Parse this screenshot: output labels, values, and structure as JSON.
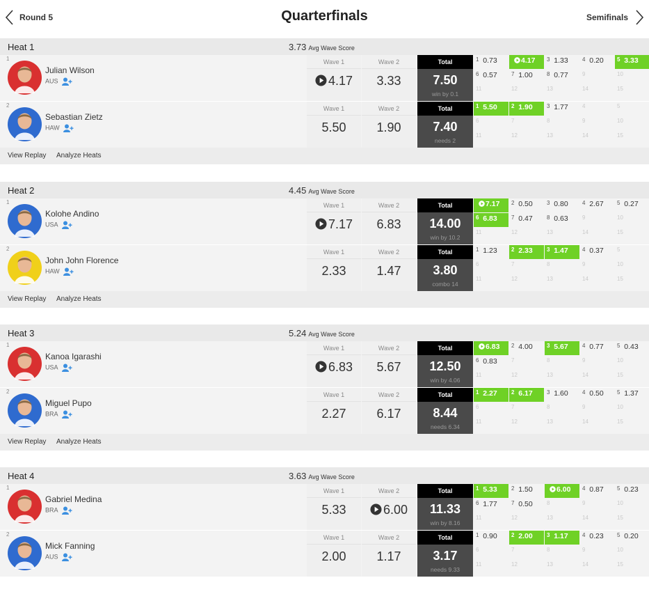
{
  "nav": {
    "prev_label": "Round 5",
    "title": "Quarterfinals",
    "next_label": "Semifinals"
  },
  "labels": {
    "avg": "Avg Wave Score",
    "wave1": "Wave 1",
    "wave2": "Wave 2",
    "total": "Total",
    "view_replay": "View Replay",
    "analyze_heats": "Analyze Heats"
  },
  "colors": {
    "accent_green": "#6fd126",
    "total_header": "#000000",
    "total_body": "#4a4a4a"
  },
  "heats": [
    {
      "name": "Heat 1",
      "avg": "3.73",
      "surfers": [
        {
          "seed": "1",
          "name": "Julian Wilson",
          "country": "AUS",
          "avatar_color": "#d93030",
          "wave1": "4.17",
          "wave1_play": true,
          "wave2": "3.33",
          "wave2_play": false,
          "total": "7.50",
          "note": "win by 0.1",
          "waves": [
            {
              "n": "1",
              "s": "0.73"
            },
            {
              "n": "",
              "s": "4.17",
              "g": true,
              "p": true
            },
            {
              "n": "3",
              "s": "1.33"
            },
            {
              "n": "4",
              "s": "0.20"
            },
            {
              "n": "5",
              "s": "3.33",
              "g": true
            },
            {
              "n": "6",
              "s": "0.57"
            },
            {
              "n": "7",
              "s": "1.00"
            },
            {
              "n": "8",
              "s": "0.77"
            },
            {
              "n": "9",
              "s": ""
            },
            {
              "n": "10",
              "s": ""
            },
            {
              "n": "11",
              "s": ""
            },
            {
              "n": "12",
              "s": ""
            },
            {
              "n": "13",
              "s": ""
            },
            {
              "n": "14",
              "s": ""
            },
            {
              "n": "15",
              "s": ""
            }
          ]
        },
        {
          "seed": "2",
          "name": "Sebastian Zietz",
          "country": "HAW",
          "avatar_color": "#2f6bcf",
          "wave1": "5.50",
          "wave1_play": false,
          "wave2": "1.90",
          "wave2_play": false,
          "total": "7.40",
          "note": "needs 2",
          "waves": [
            {
              "n": "1",
              "s": "5.50",
              "g": true
            },
            {
              "n": "2",
              "s": "1.90",
              "g": true
            },
            {
              "n": "3",
              "s": "1.77"
            },
            {
              "n": "4",
              "s": ""
            },
            {
              "n": "5",
              "s": ""
            },
            {
              "n": "6",
              "s": ""
            },
            {
              "n": "7",
              "s": ""
            },
            {
              "n": "8",
              "s": ""
            },
            {
              "n": "9",
              "s": ""
            },
            {
              "n": "10",
              "s": ""
            },
            {
              "n": "11",
              "s": ""
            },
            {
              "n": "12",
              "s": ""
            },
            {
              "n": "13",
              "s": ""
            },
            {
              "n": "14",
              "s": ""
            },
            {
              "n": "15",
              "s": ""
            }
          ]
        }
      ]
    },
    {
      "name": "Heat 2",
      "avg": "4.45",
      "surfers": [
        {
          "seed": "1",
          "name": "Kolohe Andino",
          "country": "USA",
          "avatar_color": "#2f6bcf",
          "wave1": "7.17",
          "wave1_play": true,
          "wave2": "6.83",
          "wave2_play": false,
          "total": "14.00",
          "note": "win by 10.2",
          "waves": [
            {
              "n": "",
              "s": "7.17",
              "g": true,
              "p": true
            },
            {
              "n": "2",
              "s": "0.50"
            },
            {
              "n": "3",
              "s": "0.80"
            },
            {
              "n": "4",
              "s": "2.67"
            },
            {
              "n": "5",
              "s": "0.27"
            },
            {
              "n": "6",
              "s": "6.83",
              "g": true
            },
            {
              "n": "7",
              "s": "0.47"
            },
            {
              "n": "8",
              "s": "0.63"
            },
            {
              "n": "9",
              "s": ""
            },
            {
              "n": "10",
              "s": ""
            },
            {
              "n": "11",
              "s": ""
            },
            {
              "n": "12",
              "s": ""
            },
            {
              "n": "13",
              "s": ""
            },
            {
              "n": "14",
              "s": ""
            },
            {
              "n": "15",
              "s": ""
            }
          ]
        },
        {
          "seed": "2",
          "name": "John John Florence",
          "country": "HAW",
          "avatar_color": "#f0d01a",
          "wave1": "2.33",
          "wave1_play": false,
          "wave2": "1.47",
          "wave2_play": false,
          "total": "3.80",
          "note": "combo 14",
          "waves": [
            {
              "n": "1",
              "s": "1.23"
            },
            {
              "n": "2",
              "s": "2.33",
              "g": true
            },
            {
              "n": "3",
              "s": "1.47",
              "g": true
            },
            {
              "n": "4",
              "s": "0.37"
            },
            {
              "n": "5",
              "s": ""
            },
            {
              "n": "6",
              "s": ""
            },
            {
              "n": "7",
              "s": ""
            },
            {
              "n": "8",
              "s": ""
            },
            {
              "n": "9",
              "s": ""
            },
            {
              "n": "10",
              "s": ""
            },
            {
              "n": "11",
              "s": ""
            },
            {
              "n": "12",
              "s": ""
            },
            {
              "n": "13",
              "s": ""
            },
            {
              "n": "14",
              "s": ""
            },
            {
              "n": "15",
              "s": ""
            }
          ]
        }
      ]
    },
    {
      "name": "Heat 3",
      "avg": "5.24",
      "surfers": [
        {
          "seed": "1",
          "name": "Kanoa Igarashi",
          "country": "USA",
          "avatar_color": "#d93030",
          "wave1": "6.83",
          "wave1_play": true,
          "wave2": "5.67",
          "wave2_play": false,
          "total": "12.50",
          "note": "win by 4.06",
          "waves": [
            {
              "n": "",
              "s": "6.83",
              "g": true,
              "p": true
            },
            {
              "n": "2",
              "s": "4.00"
            },
            {
              "n": "3",
              "s": "5.67",
              "g": true
            },
            {
              "n": "4",
              "s": "0.77"
            },
            {
              "n": "5",
              "s": "0.43"
            },
            {
              "n": "6",
              "s": "0.83"
            },
            {
              "n": "7",
              "s": ""
            },
            {
              "n": "8",
              "s": ""
            },
            {
              "n": "9",
              "s": ""
            },
            {
              "n": "10",
              "s": ""
            },
            {
              "n": "11",
              "s": ""
            },
            {
              "n": "12",
              "s": ""
            },
            {
              "n": "13",
              "s": ""
            },
            {
              "n": "14",
              "s": ""
            },
            {
              "n": "15",
              "s": ""
            }
          ]
        },
        {
          "seed": "2",
          "name": "Miguel Pupo",
          "country": "BRA",
          "avatar_color": "#2f6bcf",
          "wave1": "2.27",
          "wave1_play": false,
          "wave2": "6.17",
          "wave2_play": false,
          "total": "8.44",
          "note": "needs 6.34",
          "waves": [
            {
              "n": "1",
              "s": "2.27",
              "g": true
            },
            {
              "n": "2",
              "s": "6.17",
              "g": true
            },
            {
              "n": "3",
              "s": "1.60"
            },
            {
              "n": "4",
              "s": "0.50"
            },
            {
              "n": "5",
              "s": "1.37"
            },
            {
              "n": "6",
              "s": ""
            },
            {
              "n": "7",
              "s": ""
            },
            {
              "n": "8",
              "s": ""
            },
            {
              "n": "9",
              "s": ""
            },
            {
              "n": "10",
              "s": ""
            },
            {
              "n": "11",
              "s": ""
            },
            {
              "n": "12",
              "s": ""
            },
            {
              "n": "13",
              "s": ""
            },
            {
              "n": "14",
              "s": ""
            },
            {
              "n": "15",
              "s": ""
            }
          ]
        }
      ]
    },
    {
      "name": "Heat 4",
      "avg": "3.63",
      "surfers": [
        {
          "seed": "1",
          "name": "Gabriel Medina",
          "country": "BRA",
          "avatar_color": "#d93030",
          "wave1": "5.33",
          "wave1_play": false,
          "wave2": "6.00",
          "wave2_play": true,
          "total": "11.33",
          "note": "win by 8.16",
          "waves": [
            {
              "n": "1",
              "s": "5.33",
              "g": true
            },
            {
              "n": "2",
              "s": "1.50"
            },
            {
              "n": "",
              "s": "6.00",
              "g": true,
              "p": true
            },
            {
              "n": "4",
              "s": "0.87"
            },
            {
              "n": "5",
              "s": "0.23"
            },
            {
              "n": "6",
              "s": "1.77"
            },
            {
              "n": "7",
              "s": "0.50"
            },
            {
              "n": "8",
              "s": ""
            },
            {
              "n": "9",
              "s": ""
            },
            {
              "n": "10",
              "s": ""
            },
            {
              "n": "11",
              "s": ""
            },
            {
              "n": "12",
              "s": ""
            },
            {
              "n": "13",
              "s": ""
            },
            {
              "n": "14",
              "s": ""
            },
            {
              "n": "15",
              "s": ""
            }
          ]
        },
        {
          "seed": "2",
          "name": "Mick Fanning",
          "country": "AUS",
          "avatar_color": "#2f6bcf",
          "wave1": "2.00",
          "wave1_play": false,
          "wave2": "1.17",
          "wave2_play": false,
          "total": "3.17",
          "note": "needs 9.33",
          "waves": [
            {
              "n": "1",
              "s": "0.90"
            },
            {
              "n": "2",
              "s": "2.00",
              "g": true
            },
            {
              "n": "3",
              "s": "1.17",
              "g": true
            },
            {
              "n": "4",
              "s": "0.23"
            },
            {
              "n": "5",
              "s": "0.20"
            },
            {
              "n": "6",
              "s": ""
            },
            {
              "n": "7",
              "s": ""
            },
            {
              "n": "8",
              "s": ""
            },
            {
              "n": "9",
              "s": ""
            },
            {
              "n": "10",
              "s": ""
            },
            {
              "n": "11",
              "s": ""
            },
            {
              "n": "12",
              "s": ""
            },
            {
              "n": "13",
              "s": ""
            },
            {
              "n": "14",
              "s": ""
            },
            {
              "n": "15",
              "s": ""
            }
          ]
        }
      ]
    }
  ]
}
